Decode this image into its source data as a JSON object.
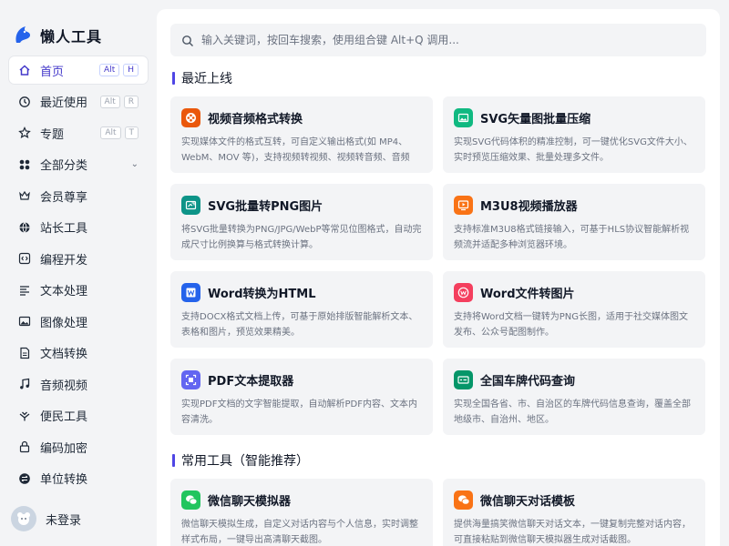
{
  "app": {
    "name": "懒人工具"
  },
  "search": {
    "placeholder": "输入关键词，按回车搜索，使用组合键 Alt+Q 调用..."
  },
  "sidebar": {
    "items": [
      {
        "label": "首页",
        "icon": "home-icon",
        "kbd": [
          "Alt",
          "H"
        ],
        "active": true
      },
      {
        "label": "最近使用",
        "icon": "clock-icon",
        "kbd": [
          "Alt",
          "R"
        ]
      },
      {
        "label": "专题",
        "icon": "star-icon",
        "kbd": [
          "Alt",
          "T"
        ]
      },
      {
        "label": "全部分类",
        "icon": "grid-icon",
        "expand": "⌄"
      },
      {
        "label": "会员尊享",
        "icon": "crown-icon"
      },
      {
        "label": "站长工具",
        "icon": "globe-icon"
      },
      {
        "label": "编程开发",
        "icon": "code-icon"
      },
      {
        "label": "文本处理",
        "icon": "text-icon"
      },
      {
        "label": "图像处理",
        "icon": "image-icon"
      },
      {
        "label": "文档转换",
        "icon": "document-icon"
      },
      {
        "label": "音频视频",
        "icon": "music-icon"
      },
      {
        "label": "便民工具",
        "icon": "hands-icon"
      },
      {
        "label": "编码加密",
        "icon": "lock-icon"
      },
      {
        "label": "单位转换",
        "icon": "convert-icon"
      }
    ]
  },
  "user": {
    "name": "未登录"
  },
  "sections": [
    {
      "title": "最近上线"
    },
    {
      "title": "常用工具（智能推荐）"
    }
  ],
  "cards": [
    {
      "title": "视频音频格式转换",
      "desc": "实现媒体文件的格式互转，可自定义输出格式(如 MP4、WebM、MOV 等)，支持视频转视频、视频转音频、音频转...",
      "color": "#ea580c",
      "icon": "film-icon"
    },
    {
      "title": "SVG矢量图批量压缩",
      "desc": "实现SVG代码体积的精准控制，可一键优化SVG文件大小、实时预览压缩效果、批量处理多文件。",
      "color": "#10b981",
      "icon": "image-compress-icon"
    },
    {
      "title": "SVG批量转PNG图片",
      "desc": "将SVG批量转换为PNG/JPG/WebP等常见位图格式，自动完成尺寸比例换算与格式转换计算。",
      "color": "#0d9488",
      "icon": "image-convert-icon"
    },
    {
      "title": "M3U8视频播放器",
      "desc": "支持标准M3U8格式链接输入，可基于HLS协议智能解析视频流并适配多种浏览器环境。",
      "color": "#f97316",
      "icon": "player-icon"
    },
    {
      "title": "Word转换为HTML",
      "desc": "支持DOCX格式文档上传，可基于原始排版智能解析文本、表格和图片，预览效果精美。",
      "color": "#2563eb",
      "icon": "word-icon"
    },
    {
      "title": "Word文件转图片",
      "desc": "支持将Word文档一键转为PNG长图，适用于社交媒体图文发布、公众号配图制作。",
      "color": "#f43f5e",
      "icon": "word-image-icon"
    },
    {
      "title": "PDF文本提取器",
      "desc": "实现PDF文档的文字智能提取，自动解析PDF内容、文本内容清洗。",
      "color": "#6366f1",
      "icon": "scan-icon"
    },
    {
      "title": "全国车牌代码查询",
      "desc": "实现全国各省、市、自治区的车牌代码信息查询，覆盖全部地级市、自治州、地区。",
      "color": "#059669",
      "icon": "license-plate-icon"
    },
    {
      "title": "微信聊天模拟器",
      "desc": "微信聊天模拟生成，自定义对话内容与个人信息，实时调整样式布局，一键导出高清聊天截图。",
      "color": "#22c55e",
      "icon": "wechat-icon"
    },
    {
      "title": "微信聊天对话模板",
      "desc": "提供海量搞笑微信聊天对话文本，一键复制完整对话内容，可直接粘贴到微信聊天模拟器生成对话截图。",
      "color": "#f97316",
      "icon": "wechat-template-icon"
    }
  ]
}
